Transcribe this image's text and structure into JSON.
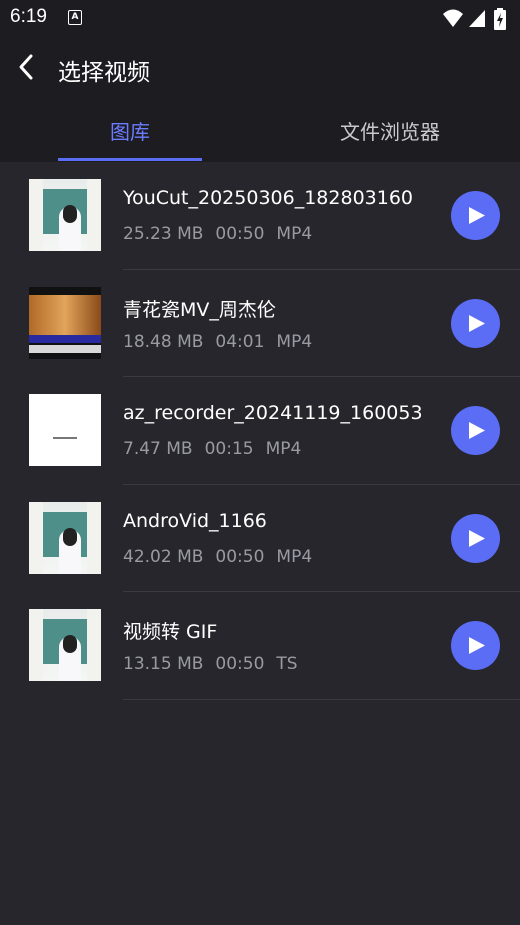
{
  "status_bar": {
    "time": "6:19",
    "app_icon_letter": "A"
  },
  "header": {
    "title": "选择视频"
  },
  "tabs": [
    {
      "label": "图库",
      "active": true
    },
    {
      "label": "文件浏览器",
      "active": false
    }
  ],
  "colors": {
    "accent": "#5b6cf5",
    "background": "#26262c",
    "header": "#1c1c21"
  },
  "videos": [
    {
      "title": "YouCut_20250306_182803160",
      "size": "25.23 MB",
      "duration": "00:50",
      "format": "MP4",
      "thumbnail": "room"
    },
    {
      "title": "青花瓷MV_周杰伦",
      "size": "18.48 MB",
      "duration": "04:01",
      "format": "MP4",
      "thumbnail": "mv"
    },
    {
      "title": "az_recorder_20241119_160053",
      "size": "7.47 MB",
      "duration": "00:15",
      "format": "MP4",
      "thumbnail": "blank"
    },
    {
      "title": "AndroVid_1166",
      "size": "42.02 MB",
      "duration": "00:50",
      "format": "MP4",
      "thumbnail": "room"
    },
    {
      "title": "视频转 GIF",
      "size": "13.15 MB",
      "duration": "00:50",
      "format": "TS",
      "thumbnail": "room"
    }
  ]
}
